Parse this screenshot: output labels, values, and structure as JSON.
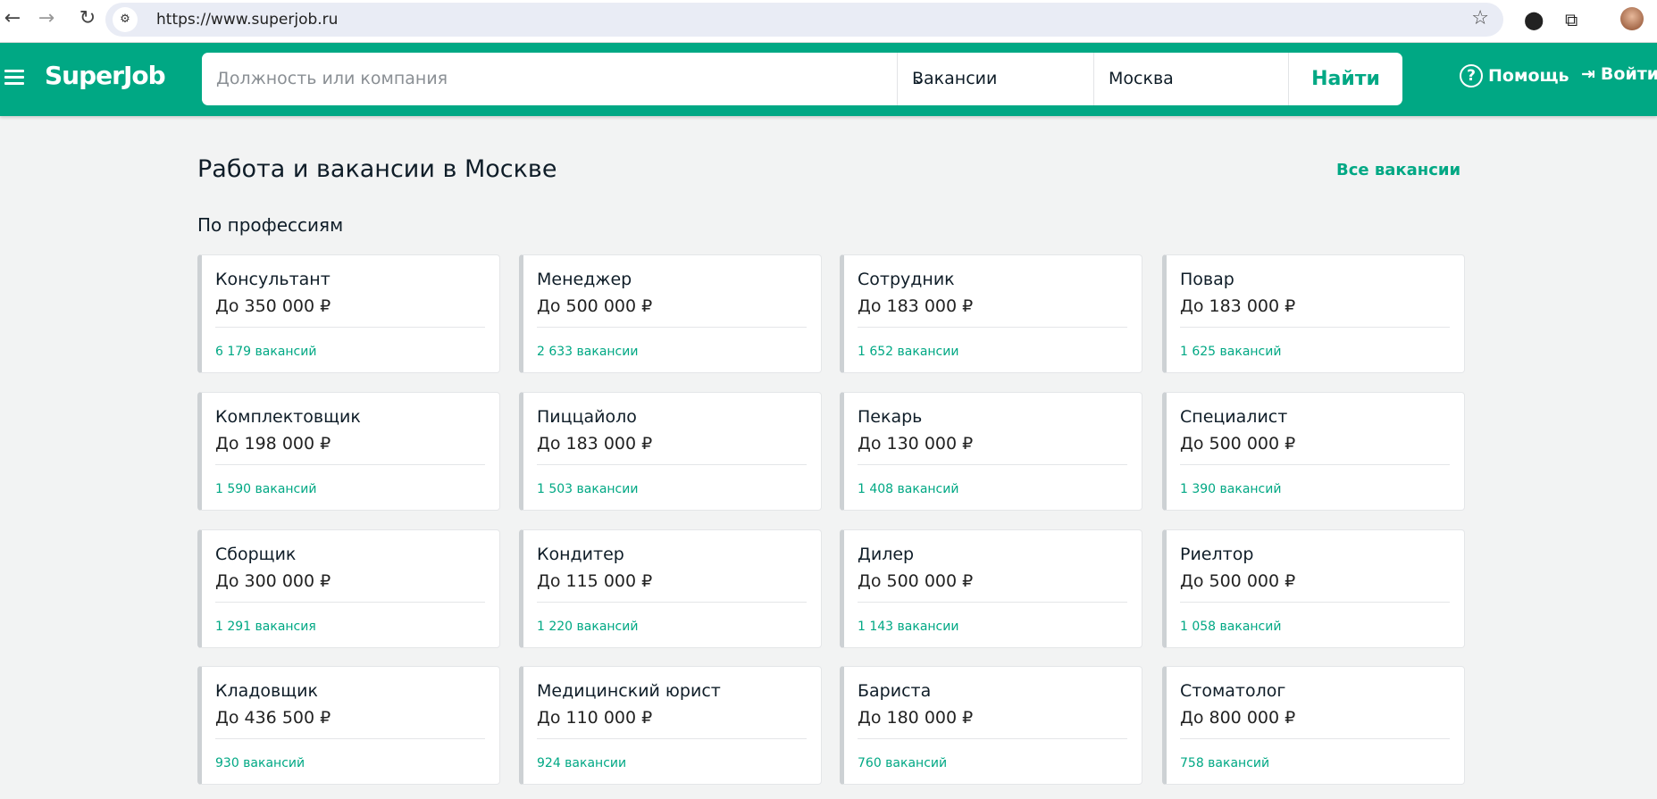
{
  "browser": {
    "url": "https://www.superjob.ru"
  },
  "header": {
    "logo": "SuperJob",
    "search_placeholder": "Должность или компания",
    "search_type": "Вакансии",
    "city": "Москва",
    "find": "Найти",
    "help": "Помощь",
    "login": "Войти"
  },
  "main": {
    "title": "Работа и вакансии в Москве",
    "all_link": "Все вакансии",
    "section": "По профессиям",
    "cards": [
      {
        "title": "Консультант",
        "salary": "До 350 000 ₽",
        "count": "6 179 вакансий"
      },
      {
        "title": "Менеджер",
        "salary": "До 500 000 ₽",
        "count": "2 633 вакансии"
      },
      {
        "title": "Сотрудник",
        "salary": "До 183 000 ₽",
        "count": "1 652 вакансии"
      },
      {
        "title": "Повар",
        "salary": "До 183 000 ₽",
        "count": "1 625 вакансий"
      },
      {
        "title": "Комплектовщик",
        "salary": "До 198 000 ₽",
        "count": "1 590 вакансий"
      },
      {
        "title": "Пиццайоло",
        "salary": "До 183 000 ₽",
        "count": "1 503 вакансии"
      },
      {
        "title": "Пекарь",
        "salary": "До 130 000 ₽",
        "count": "1 408 вакансий"
      },
      {
        "title": "Специалист",
        "salary": "До 500 000 ₽",
        "count": "1 390 вакансий"
      },
      {
        "title": "Сборщик",
        "salary": "До 300 000 ₽",
        "count": "1 291 вакансия"
      },
      {
        "title": "Кондитер",
        "salary": "До 115 000 ₽",
        "count": "1 220 вакансий"
      },
      {
        "title": "Дилер",
        "salary": "До 500 000 ₽",
        "count": "1 143 вакансии"
      },
      {
        "title": "Риелтор",
        "salary": "До 500 000 ₽",
        "count": "1 058 вакансий"
      },
      {
        "title": "Кладовщик",
        "salary": "До 436 500 ₽",
        "count": "930 вакансий"
      },
      {
        "title": "Медицинский юрист",
        "salary": "До 110 000 ₽",
        "count": "924 вакансии"
      },
      {
        "title": "Бариста",
        "salary": "До 180 000 ₽",
        "count": "760 вакансий"
      },
      {
        "title": "Стоматолог",
        "salary": "До 800 000 ₽",
        "count": "758 вакансий"
      }
    ]
  },
  "colors": {
    "brand": "#00a884"
  }
}
